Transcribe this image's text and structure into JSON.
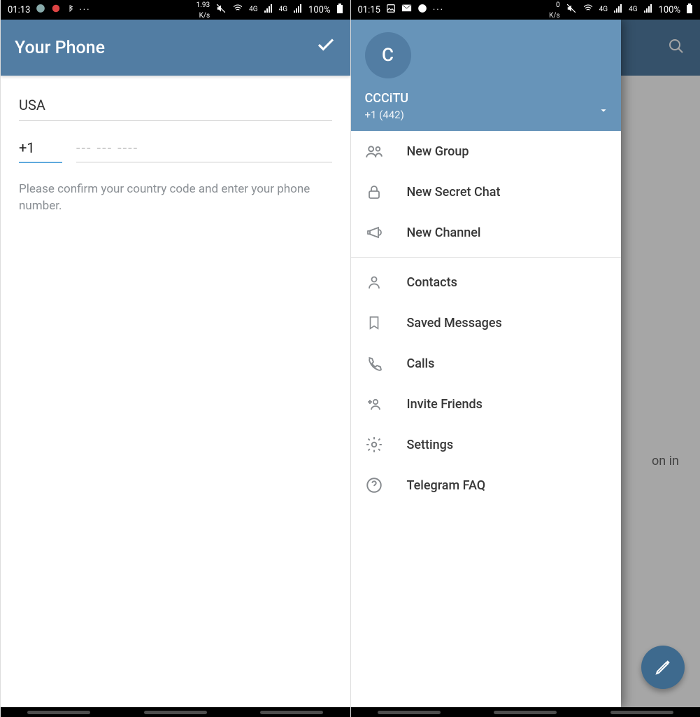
{
  "screen1": {
    "status": {
      "time": "01:13",
      "speed_val": "1.93",
      "speed_unit": "K/s",
      "net1": "4G",
      "net2": "4G",
      "battery": "100%"
    },
    "header": {
      "title": "Your Phone"
    },
    "form": {
      "country": "USA",
      "code": "+1",
      "phone_placeholder": "--- --- ----",
      "helper": "Please confirm your country code and enter your phone number."
    }
  },
  "screen2": {
    "status": {
      "time": "01:15",
      "speed_val": "0",
      "speed_unit": "K/s",
      "net1": "4G",
      "net2": "4G",
      "battery": "100%"
    },
    "behind_text_fragment": "on in",
    "drawer": {
      "avatar_letter": "C",
      "username": "CCCiTU",
      "phone": "+1 (442)",
      "group1": [
        {
          "id": "new-group",
          "label": "New Group",
          "icon": "group"
        },
        {
          "id": "new-secret-chat",
          "label": "New Secret Chat",
          "icon": "lock"
        },
        {
          "id": "new-channel",
          "label": "New Channel",
          "icon": "megaphone"
        }
      ],
      "group2": [
        {
          "id": "contacts",
          "label": "Contacts",
          "icon": "person"
        },
        {
          "id": "saved-messages",
          "label": "Saved Messages",
          "icon": "bookmark"
        },
        {
          "id": "calls",
          "label": "Calls",
          "icon": "phone"
        },
        {
          "id": "invite-friends",
          "label": "Invite Friends",
          "icon": "invite"
        },
        {
          "id": "settings",
          "label": "Settings",
          "icon": "gear"
        },
        {
          "id": "telegram-faq",
          "label": "Telegram FAQ",
          "icon": "help"
        }
      ]
    }
  }
}
